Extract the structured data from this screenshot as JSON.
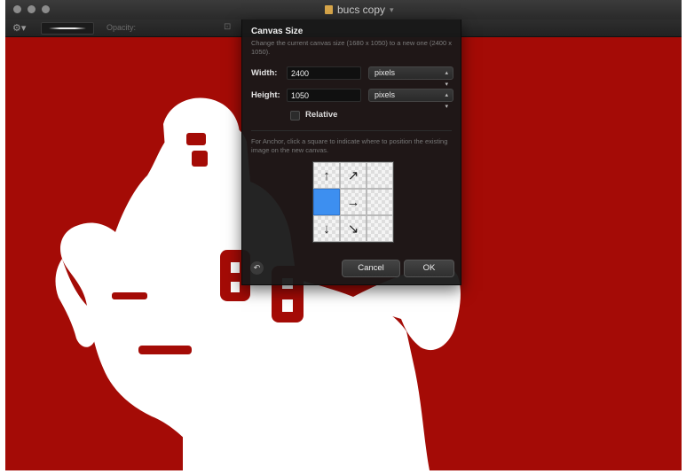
{
  "window": {
    "title": "bucs copy",
    "canvas_color": "#a40b06"
  },
  "toolbar": {
    "opacity_label": "Opacity:",
    "tool_icon": "gear-icon",
    "lock_icon": "lock-icon"
  },
  "dialog": {
    "title": "Canvas Size",
    "description": "Change the current canvas size (1680 x 1050) to a new one (2400 x 1050).",
    "width_label": "Width:",
    "width_value": "2400",
    "width_unit": "pixels",
    "height_label": "Height:",
    "height_value": "1050",
    "height_unit": "pixels",
    "relative_label": "Relative",
    "relative_checked": false,
    "anchor_help": "For Anchor, click a square to indicate where to position the existing image on the new canvas.",
    "anchor_selected": "middle-left",
    "anchor_cells": [
      {
        "name": "top-left",
        "glyph": "↑"
      },
      {
        "name": "top-center",
        "glyph": "↗"
      },
      {
        "name": "top-right",
        "glyph": ""
      },
      {
        "name": "middle-left",
        "glyph": ""
      },
      {
        "name": "middle-center",
        "glyph": "→"
      },
      {
        "name": "middle-right",
        "glyph": ""
      },
      {
        "name": "bottom-left",
        "glyph": "↓"
      },
      {
        "name": "bottom-center",
        "glyph": "↘"
      },
      {
        "name": "bottom-right",
        "glyph": ""
      }
    ],
    "reset_glyph": "↶",
    "cancel_label": "Cancel",
    "ok_label": "OK"
  }
}
